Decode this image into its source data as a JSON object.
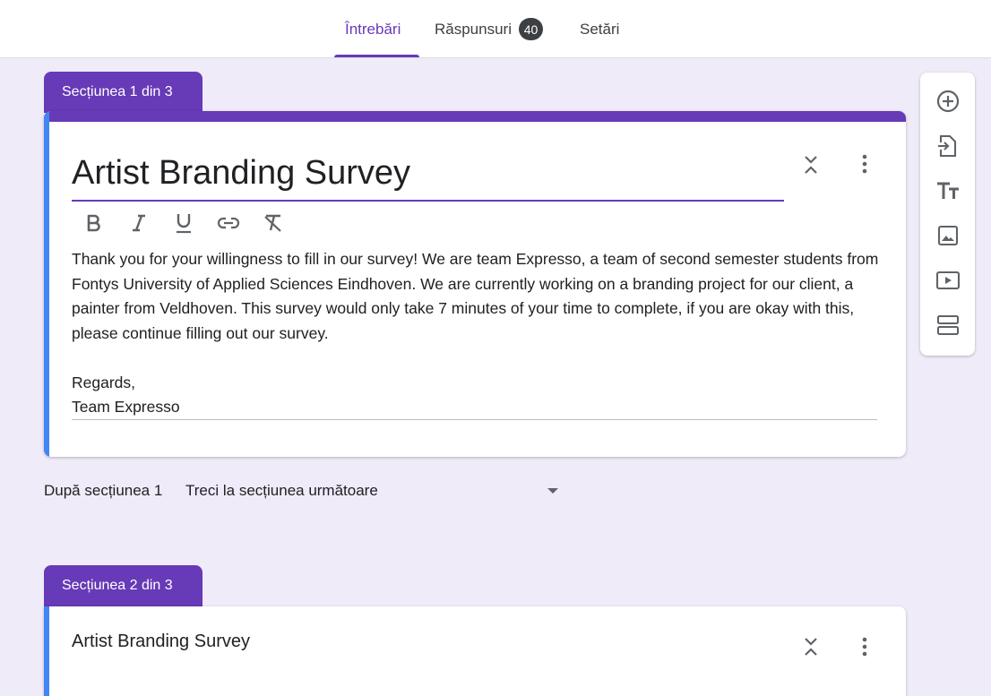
{
  "tabs": [
    {
      "label": "Întrebări",
      "active": true
    },
    {
      "label": "Răspunsuri",
      "badge": "40"
    },
    {
      "label": "Setări"
    }
  ],
  "section1": {
    "tab_label": "Secțiunea 1 din 3",
    "title": "Artist Branding Survey",
    "description": [
      "Thank you for your willingness to fill in our survey! We are team Expresso, a team of second semester students from Fontys University of Applied Sciences Eindhoven. We are currently working on a branding project for our client, a painter from Veldhoven. This survey would only take 7 minutes of your time to complete, if you are okay with this, please continue filling out our survey.",
      "",
      "Regards,",
      "Team Expresso"
    ],
    "format_buttons": [
      "bold-icon",
      "italic-icon",
      "underline-icon",
      "link-icon",
      "clear-format-icon"
    ]
  },
  "after_section": {
    "label": "După secțiunea 1",
    "selected": "Treci la secțiunea următoare"
  },
  "section2": {
    "tab_label": "Secțiunea 2 din 3",
    "title": "Artist Branding Survey"
  },
  "toolbar": [
    "add-question-icon",
    "import-questions-icon",
    "add-title-icon",
    "add-image-icon",
    "add-video-icon",
    "add-section-icon"
  ],
  "colors": {
    "accent": "#673ab7",
    "background": "#f0ebf8",
    "focus": "#4285f4"
  }
}
